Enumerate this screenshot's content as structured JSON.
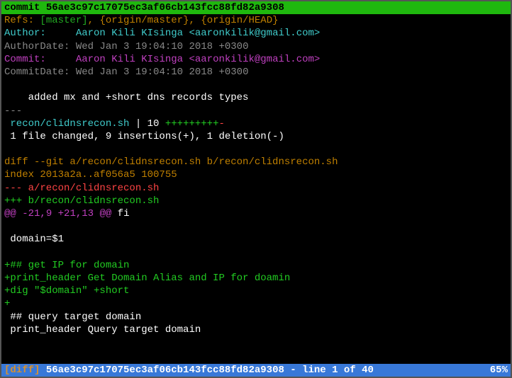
{
  "commit_header": {
    "prefix": "commit ",
    "hash": "56ae3c97c17075ec3af06cb143fcc88fd82a9308"
  },
  "refs": {
    "prefix": "Refs: ",
    "master": "[master]",
    "origin_master": "{origin/master}",
    "origin_head": "{origin/HEAD}"
  },
  "author": {
    "label": "Author:     ",
    "name": "Aaron Kili KIsinga ",
    "email": "<aaronkilik@gmail.com>"
  },
  "author_date": {
    "label": "AuthorDate: ",
    "value": "Wed Jan 3 19:04:10 2018 +0300"
  },
  "commit_author": {
    "label": "Commit:     ",
    "name": "Aaron Kili KIsinga ",
    "email": "<aaronkilik@gmail.com>"
  },
  "commit_date": {
    "label": "CommitDate: ",
    "value": "Wed Jan 3 19:04:10 2018 +0300"
  },
  "message": "    added mx and +short dns records types",
  "separator": "---",
  "diffstat": {
    "file": " recon/clidnsrecon.sh",
    "pipe": " | ",
    "count": "10 ",
    "plus": "+++++++++",
    "minus": "-"
  },
  "summary": " 1 file changed, 9 insertions(+), 1 deletion(-)",
  "diff_header": "diff --git a/recon/clidnsrecon.sh b/recon/clidnsrecon.sh",
  "index_line": "index 2013a2a..af056a5 100755",
  "old_file": "--- a/recon/clidnsrecon.sh",
  "new_file": "+++ b/recon/clidnsrecon.sh",
  "hunk": {
    "marker": "@@ ",
    "old": "-21,9 ",
    "new": "+21,13 ",
    "marker2": "@@ ",
    "context": "fi"
  },
  "lines": {
    "domain": " domain=$1",
    "add1": "+## get IP for domain",
    "add2": "+print_header Get Domain Alias and IP for doamin",
    "add3": "+dig \"$domain\" +short",
    "add4": "+",
    "ctx1": " ## query target domain",
    "ctx2": " print_header Query target domain"
  },
  "status": {
    "label": "[diff] ",
    "hash": "56ae3c97c17075ec3af06cb143fcc88fd82a9308",
    "position": " - line 1 of 40",
    "percent": "65%"
  }
}
